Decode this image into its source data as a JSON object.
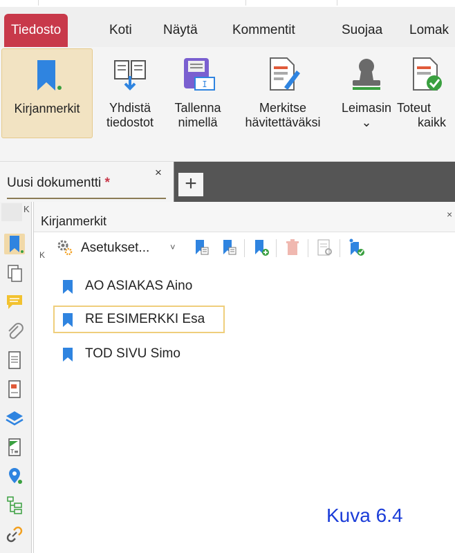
{
  "menu": {
    "tabs": [
      {
        "label": "Tiedosto",
        "active": true
      },
      {
        "label": "Koti"
      },
      {
        "label": "Näytä"
      },
      {
        "label": "Kommentit"
      },
      {
        "label": "Suojaa"
      },
      {
        "label": "Lomak"
      }
    ]
  },
  "ribbon": {
    "buttons": [
      {
        "line1": "Kirjanmerkit",
        "line2": "",
        "icon": "bookmark-icon",
        "active": true
      },
      {
        "line1": "Yhdistä",
        "line2": "tiedostot",
        "icon": "merge-files-icon"
      },
      {
        "line1": "Tallenna",
        "line2": "nimellä",
        "icon": "save-as-icon"
      },
      {
        "line1": "Merkitse",
        "line2": "hävitettäväksi",
        "icon": "mark-redaction-icon"
      },
      {
        "line1": "Leimasin",
        "line2": "⌄",
        "icon": "stamp-icon"
      },
      {
        "line1": "Toteut",
        "line2": "kaikk",
        "icon": "apply-all-icon"
      }
    ]
  },
  "document_tab": {
    "name": "Uusi dokumentti",
    "modified_mark": "*",
    "close": "×",
    "new_tab": "+"
  },
  "panel": {
    "title": "Kirjanmerkit",
    "close": "×",
    "collapse": "K",
    "toolbar": {
      "settings_label": "Asetukset...",
      "caret": "˅"
    },
    "bookmarks": [
      {
        "label": "AO ASIAKAS Aino",
        "selected": false
      },
      {
        "label": "RE ESIMERKKI Esa",
        "selected": true
      },
      {
        "label": "TOD SIVU Simo",
        "selected": false
      }
    ]
  },
  "sidebar": {
    "collapse": "K"
  },
  "caption": "Kuva 6.4",
  "colors": {
    "accent_tab": "#c8394a",
    "bookmark_blue": "#2f84e0",
    "selection": "#efce7b",
    "caption": "#1a3cd8"
  }
}
